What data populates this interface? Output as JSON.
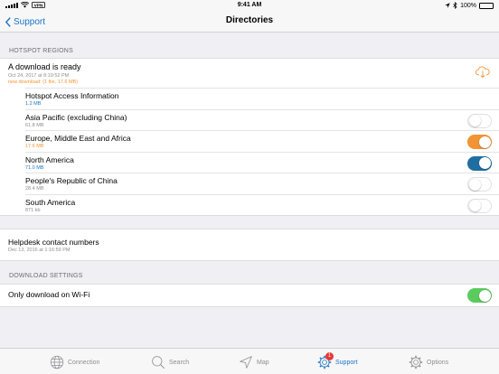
{
  "status_bar": {
    "time": "9:41 AM",
    "battery": "100%",
    "battery_level": 1.0
  },
  "nav": {
    "back_label": "Support",
    "title": "Directories"
  },
  "hotspot": {
    "header": "HOTSPOT REGIONS",
    "download": {
      "title": "A download is ready",
      "date": "Oct 24, 2017 at 8:19:52 PM",
      "new_download": "new download: (1 file, 17.6 MB)"
    },
    "items": [
      {
        "name": "Hotspot Access Information",
        "size": "1.2 MB",
        "toggle": null
      },
      {
        "name": "Asia Pacific (excluding China)",
        "size": "61.8 MB",
        "toggle": "off"
      },
      {
        "name": "Europe, Middle East and Africa",
        "size": "17.6 MB",
        "toggle": "on-orange"
      },
      {
        "name": "North America",
        "size": "71.0 MB",
        "toggle": "on-blue"
      },
      {
        "name": "People's Republic of China",
        "size": "28.4 MB",
        "toggle": "off"
      },
      {
        "name": "South America",
        "size": "871 kb",
        "toggle": "off"
      }
    ]
  },
  "helpdesk": {
    "title": "Helpdesk contact numbers",
    "date": "Dec 13, 2016 at 1:16:59 PM"
  },
  "download_settings": {
    "header": "DOWNLOAD SETTINGS",
    "wifi_label": "Only download on Wi-Fi",
    "wifi_toggle": "on"
  },
  "tabs": [
    {
      "label": "Connection",
      "icon": "globe-icon"
    },
    {
      "label": "Search",
      "icon": "search-icon"
    },
    {
      "label": "Map",
      "icon": "map-arrow-icon"
    },
    {
      "label": "Support",
      "icon": "gear-icon",
      "badge": "1"
    },
    {
      "label": "Options",
      "icon": "options-gear-icon"
    }
  ],
  "colors": {
    "accent": "#1a74c6",
    "orange": "#f29433",
    "blue_toggle": "#1f6ea1",
    "green_toggle": "#5ccb5f",
    "badge": "#e53935"
  }
}
